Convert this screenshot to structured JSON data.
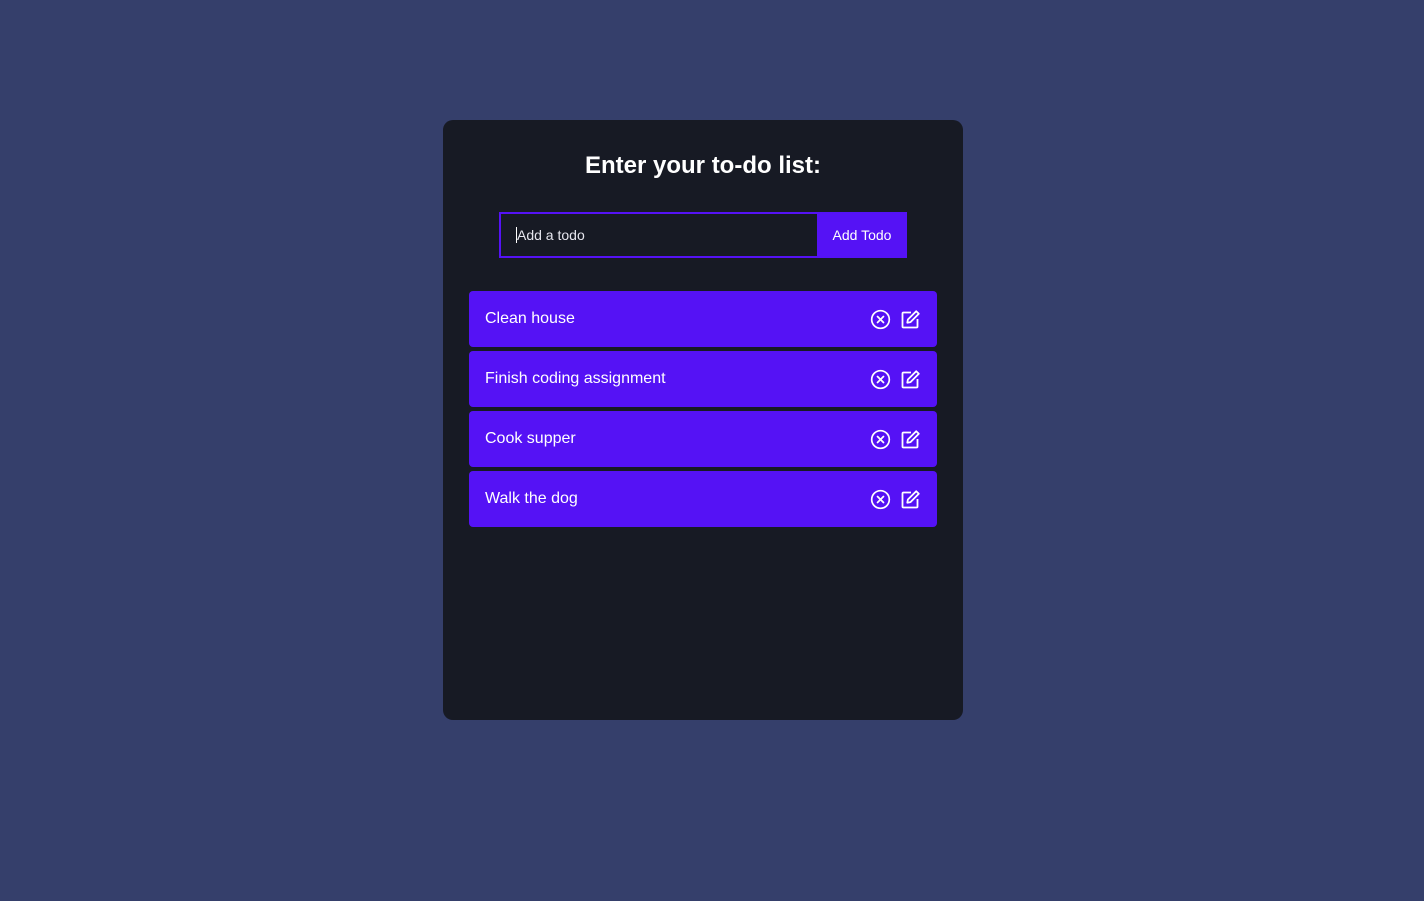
{
  "header": {
    "title": "Enter your to-do list:"
  },
  "form": {
    "placeholder": "Add a todo",
    "value": "",
    "add_label": "Add Todo"
  },
  "todos": [
    {
      "text": "Clean house",
      "delete_icon": "circle-x-icon",
      "edit_icon": "edit-icon"
    },
    {
      "text": "Finish coding assignment",
      "delete_icon": "circle-x-icon",
      "edit_icon": "edit-icon"
    },
    {
      "text": "Cook supper",
      "delete_icon": "circle-x-icon",
      "edit_icon": "edit-icon"
    },
    {
      "text": "Walk the dog",
      "delete_icon": "circle-x-icon",
      "edit_icon": "edit-icon"
    }
  ],
  "colors": {
    "page_background": "#353f6b",
    "card_background": "#171a24",
    "accent": "#5512f5",
    "text": "#ffffff"
  }
}
